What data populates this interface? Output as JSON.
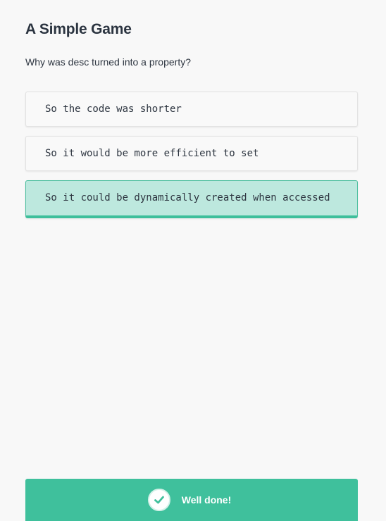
{
  "header": {
    "title": "A Simple Game"
  },
  "question": {
    "text": "Why was desc turned into a property?"
  },
  "options": [
    {
      "label": "So the code was shorter",
      "state": "default"
    },
    {
      "label": "So it would be more efficient to set",
      "state": "default"
    },
    {
      "label": "So it could be dynamically created when accessed",
      "state": "correct"
    }
  ],
  "result": {
    "label": "Well done!",
    "icon": "checkmark-icon"
  },
  "colors": {
    "background": "#f8f8f8",
    "accent": "#3fc09c",
    "correct_fill": "#bde8de",
    "text": "#2d3540"
  }
}
